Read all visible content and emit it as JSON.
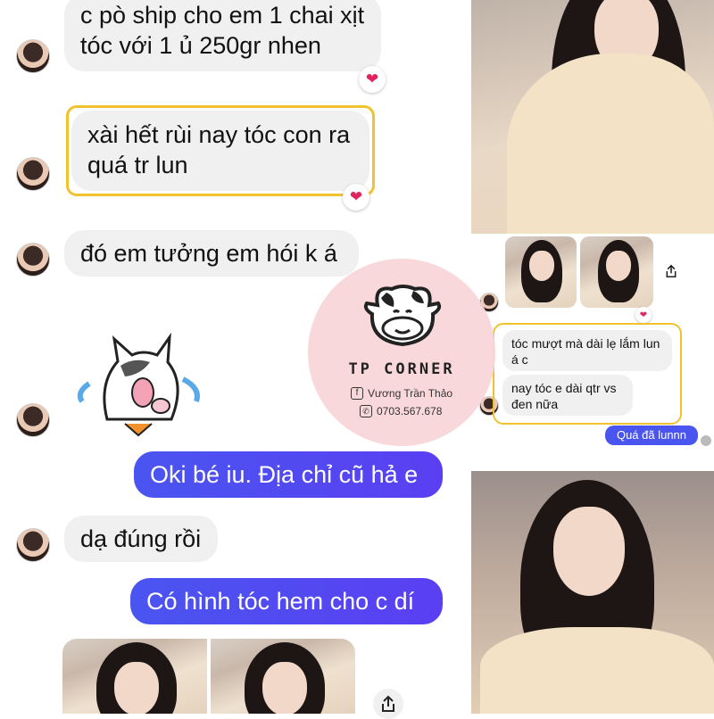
{
  "messages": {
    "m1": "c pò ship cho em 1 chai xịt tóc với 1 ủ 250gr nhen",
    "m2": "xài hết rùi nay tóc con ra quá tr lun",
    "m3": "đó em tưởng em hói k á",
    "m4": "Oki bé iu. Địa chỉ cũ hả e",
    "m5": "dạ đúng rồi",
    "m6": "Có hình tóc hem cho c dí"
  },
  "reactions": {
    "heart": "❤"
  },
  "watermark": {
    "brand": "TP CORNER",
    "facebook": "Vương Trần Thảo",
    "phone": "0703.567.678"
  },
  "inset": {
    "msg1": "tóc mượt mà dài lẹ lắm lun á c",
    "msg2": "nay tóc e dài qtr vs đen nữa",
    "reply": "Quá đã lunnn"
  },
  "icons": {
    "share": "share-icon",
    "heart": "heart-reaction-icon",
    "facebook": "facebook-icon",
    "phone": "phone-icon",
    "sticker": "crying-cat-sticker"
  },
  "colors": {
    "outgoing": "#4a55f0",
    "incoming": "#f0f0f0",
    "highlight": "#f2c12e",
    "watermark_bg": "#f9d5d8"
  }
}
